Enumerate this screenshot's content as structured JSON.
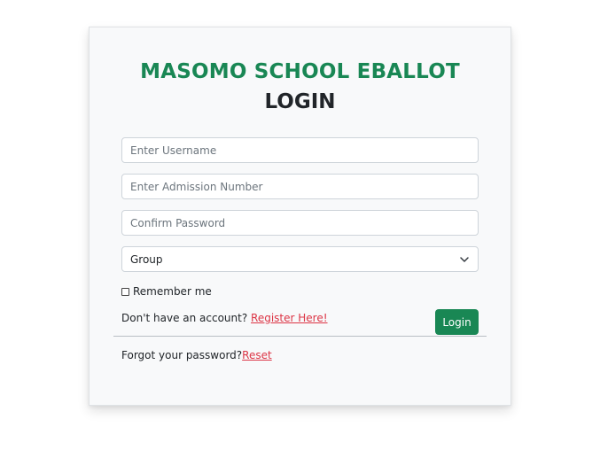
{
  "header": {
    "title": "MASOMO SCHOOL EBALLOT",
    "subtitle": "LOGIN"
  },
  "form": {
    "username_placeholder": "Enter Username",
    "admission_placeholder": "Enter Admission Number",
    "password_placeholder": "Confirm Password",
    "group_selected": "Group",
    "remember_label": "Remember me",
    "register_prompt": "Don't have an account? ",
    "register_link": "Register Here!",
    "login_label": "Login",
    "forgot_prompt": "Forgot your password?",
    "reset_link": "Reset"
  },
  "colors": {
    "accent": "#198754",
    "link": "#dc3545"
  },
  "icons": {
    "select_arrow": "chevron-down-icon"
  }
}
